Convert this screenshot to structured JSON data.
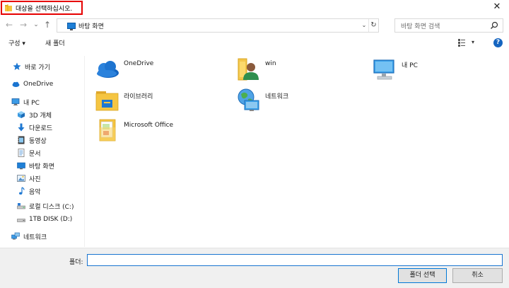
{
  "window": {
    "title": "대상을 선택하십시오.",
    "close_glyph": "✕"
  },
  "nav": {
    "back_glyph": "←",
    "forward_glyph": "→",
    "recent_glyph": "⌄",
    "up_glyph": "↑"
  },
  "address": {
    "path": "바탕 화면",
    "dropdown_glyph": "⌄",
    "refresh_glyph": "↻"
  },
  "search": {
    "placeholder": "바탕 화면 검색"
  },
  "toolbar": {
    "organize_label": "구성 ▾",
    "new_folder_label": "새 폴더",
    "view_dropdown_glyph": "▾",
    "help_glyph": "?"
  },
  "sidebar": {
    "items": [
      {
        "label": "바로 가기",
        "icon": "star-icon"
      },
      {
        "label": "OneDrive",
        "icon": "cloud-icon"
      },
      {
        "label": "내 PC",
        "icon": "pc-icon"
      },
      {
        "label": "3D 개체",
        "icon": "cube-icon"
      },
      {
        "label": "다운로드",
        "icon": "download-icon"
      },
      {
        "label": "동영상",
        "icon": "video-icon"
      },
      {
        "label": "문서",
        "icon": "document-icon"
      },
      {
        "label": "바탕 화면",
        "icon": "desktop-icon"
      },
      {
        "label": "사진",
        "icon": "picture-icon"
      },
      {
        "label": "음악",
        "icon": "music-icon"
      },
      {
        "label": "로컬 디스크 (C:)",
        "icon": "local-disk-icon"
      },
      {
        "label": "1TB DISK (D:)",
        "icon": "disk-icon"
      },
      {
        "label": "네트워크",
        "icon": "network-icon"
      }
    ]
  },
  "main": {
    "items": [
      {
        "label": "OneDrive",
        "icon": "onedrive-cloud-icon"
      },
      {
        "label": "win",
        "icon": "user-folder-icon"
      },
      {
        "label": "내 PC",
        "icon": "computer-icon"
      },
      {
        "label": "라이브러리",
        "icon": "library-folder-icon"
      },
      {
        "label": "네트워크",
        "icon": "network-globe-icon"
      },
      {
        "label": "Microsoft Office",
        "icon": "office-folder-icon"
      }
    ]
  },
  "bottom": {
    "folder_label": "폴더:",
    "folder_value": "",
    "select_button": "폴더 선택",
    "cancel_button": "취소"
  },
  "colors": {
    "highlight_border": "#e60000",
    "accent": "#0078d7",
    "folder_yellow": "#f5c542"
  }
}
